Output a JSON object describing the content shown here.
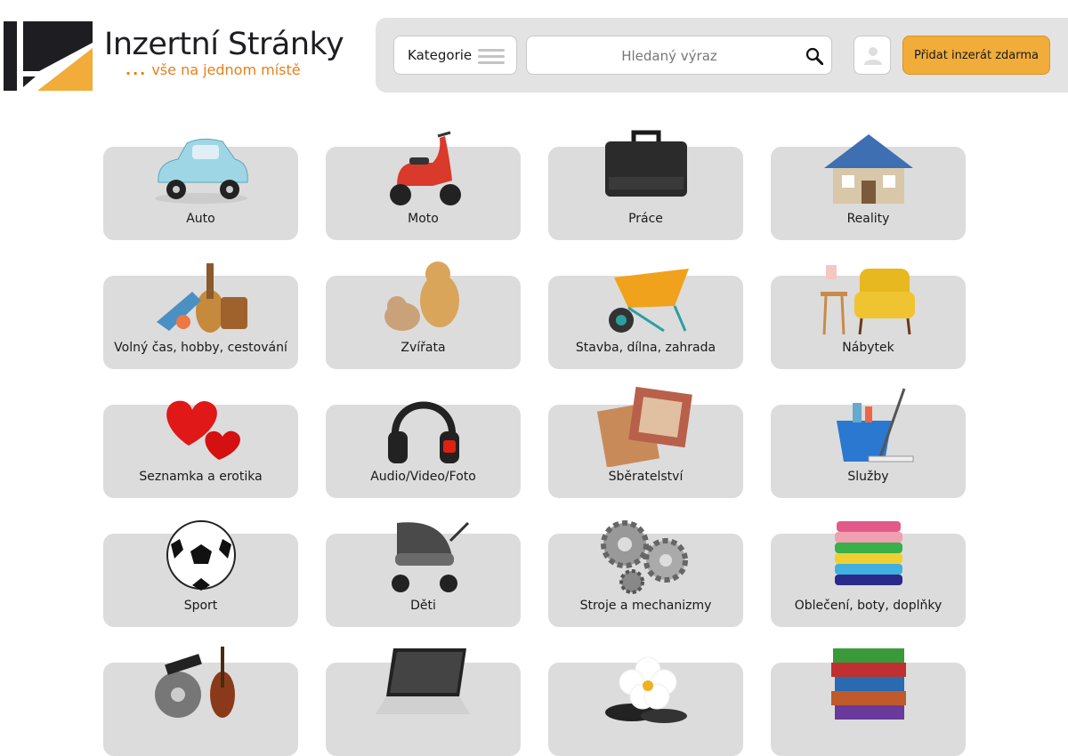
{
  "logo": {
    "title": "Inzertní Stránky",
    "dots": "...",
    "subtitle": "vše na jednom místě"
  },
  "toolbar": {
    "category_label": "Kategorie",
    "search_placeholder": "Hledaný výraz",
    "add_button": "Přidat inzerát zdarma"
  },
  "categories": [
    {
      "label": "Auto",
      "icon": "car-icon"
    },
    {
      "label": "Moto",
      "icon": "scooter-icon"
    },
    {
      "label": "Práce",
      "icon": "briefcase-icon"
    },
    {
      "label": "Reality",
      "icon": "house-icon"
    },
    {
      "label": "Volný čas, hobby, cestování",
      "icon": "hobby-icon"
    },
    {
      "label": "Zvířata",
      "icon": "pets-icon"
    },
    {
      "label": "Stavba, dílna, zahrada",
      "icon": "wheelbarrow-icon"
    },
    {
      "label": "Nábytek",
      "icon": "armchair-icon"
    },
    {
      "label": "Seznamka a erotika",
      "icon": "hearts-icon"
    },
    {
      "label": "Audio/Video/Foto",
      "icon": "headphones-icon"
    },
    {
      "label": "Sběratelství",
      "icon": "stamps-icon"
    },
    {
      "label": "Služby",
      "icon": "cleaning-bucket-icon"
    },
    {
      "label": "Sport",
      "icon": "soccer-ball-icon"
    },
    {
      "label": "Děti",
      "icon": "stroller-icon"
    },
    {
      "label": "Stroje a mechanizmy",
      "icon": "gears-icon"
    },
    {
      "label": "Oblečení, boty, doplňky",
      "icon": "clothes-stack-icon"
    },
    {
      "label": "",
      "icon": "culture-icon"
    },
    {
      "label": "",
      "icon": "laptop-icon"
    },
    {
      "label": "",
      "icon": "spa-flower-icon"
    },
    {
      "label": "",
      "icon": "books-icon"
    }
  ],
  "colors": {
    "accent": "#f1ac3a",
    "logo_orange": "#e87f1c",
    "card_bg": "#dcdcdc",
    "toolbar_bg": "#e3e3e3"
  }
}
